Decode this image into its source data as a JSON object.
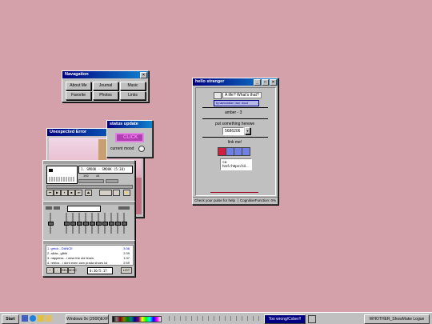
{
  "navigation": {
    "title": "Navagation",
    "buttons": [
      "About Me",
      "Journal",
      "Music",
      "Favorite",
      "Photos",
      "Links"
    ]
  },
  "hello": {
    "title": "hello stranger",
    "bubble_text": "A life? What's that?",
    "sub_text": "by iamnotafan 'uwu' cloud",
    "name": "amber - 3",
    "pulse_label": "put something herewe",
    "counter_value": "5686206",
    "link_label": "link me!",
    "code_lines": [
      "<a",
      "href='https://cil..."
    ],
    "status_left": "Check your pulse for help",
    "status_right": "CognitiveFunction: 0%"
  },
  "error": {
    "title": "Unexpected Error"
  },
  "status_update": {
    "title": "status update",
    "click_label": "CLICK",
    "mood_label": "current mood"
  },
  "winamp": {
    "track_display": "1. SMOOK - SMOOK (5:38)",
    "bitrate": "192",
    "khz": "44",
    "time": "0:00",
    "playlist": [
      {
        "num": "1.",
        "title": "grrick - DANCE",
        "time": "3:36"
      },
      {
        "num": "2.",
        "title": "alida - glitth",
        "time": "2:39"
      },
      {
        "num": "3.",
        "title": "nappiess - i miss the old times",
        "time": "1:37"
      },
      {
        "num": "4.",
        "title": "rebios - i dont even own prada shoes lol",
        "time": "2:59"
      }
    ],
    "pl_time": "0:36/5:17",
    "pl_buttons": [
      "+",
      "-",
      "SEL",
      "MISC",
      "LIST"
    ]
  },
  "taskbar": {
    "start_label": "Start",
    "task_window": "Windows 9x (2000)EXP",
    "task_song": "Too wrong/Cxber!!",
    "task_other": "WHOTHER_ShowMake Logue",
    "clock": ""
  }
}
